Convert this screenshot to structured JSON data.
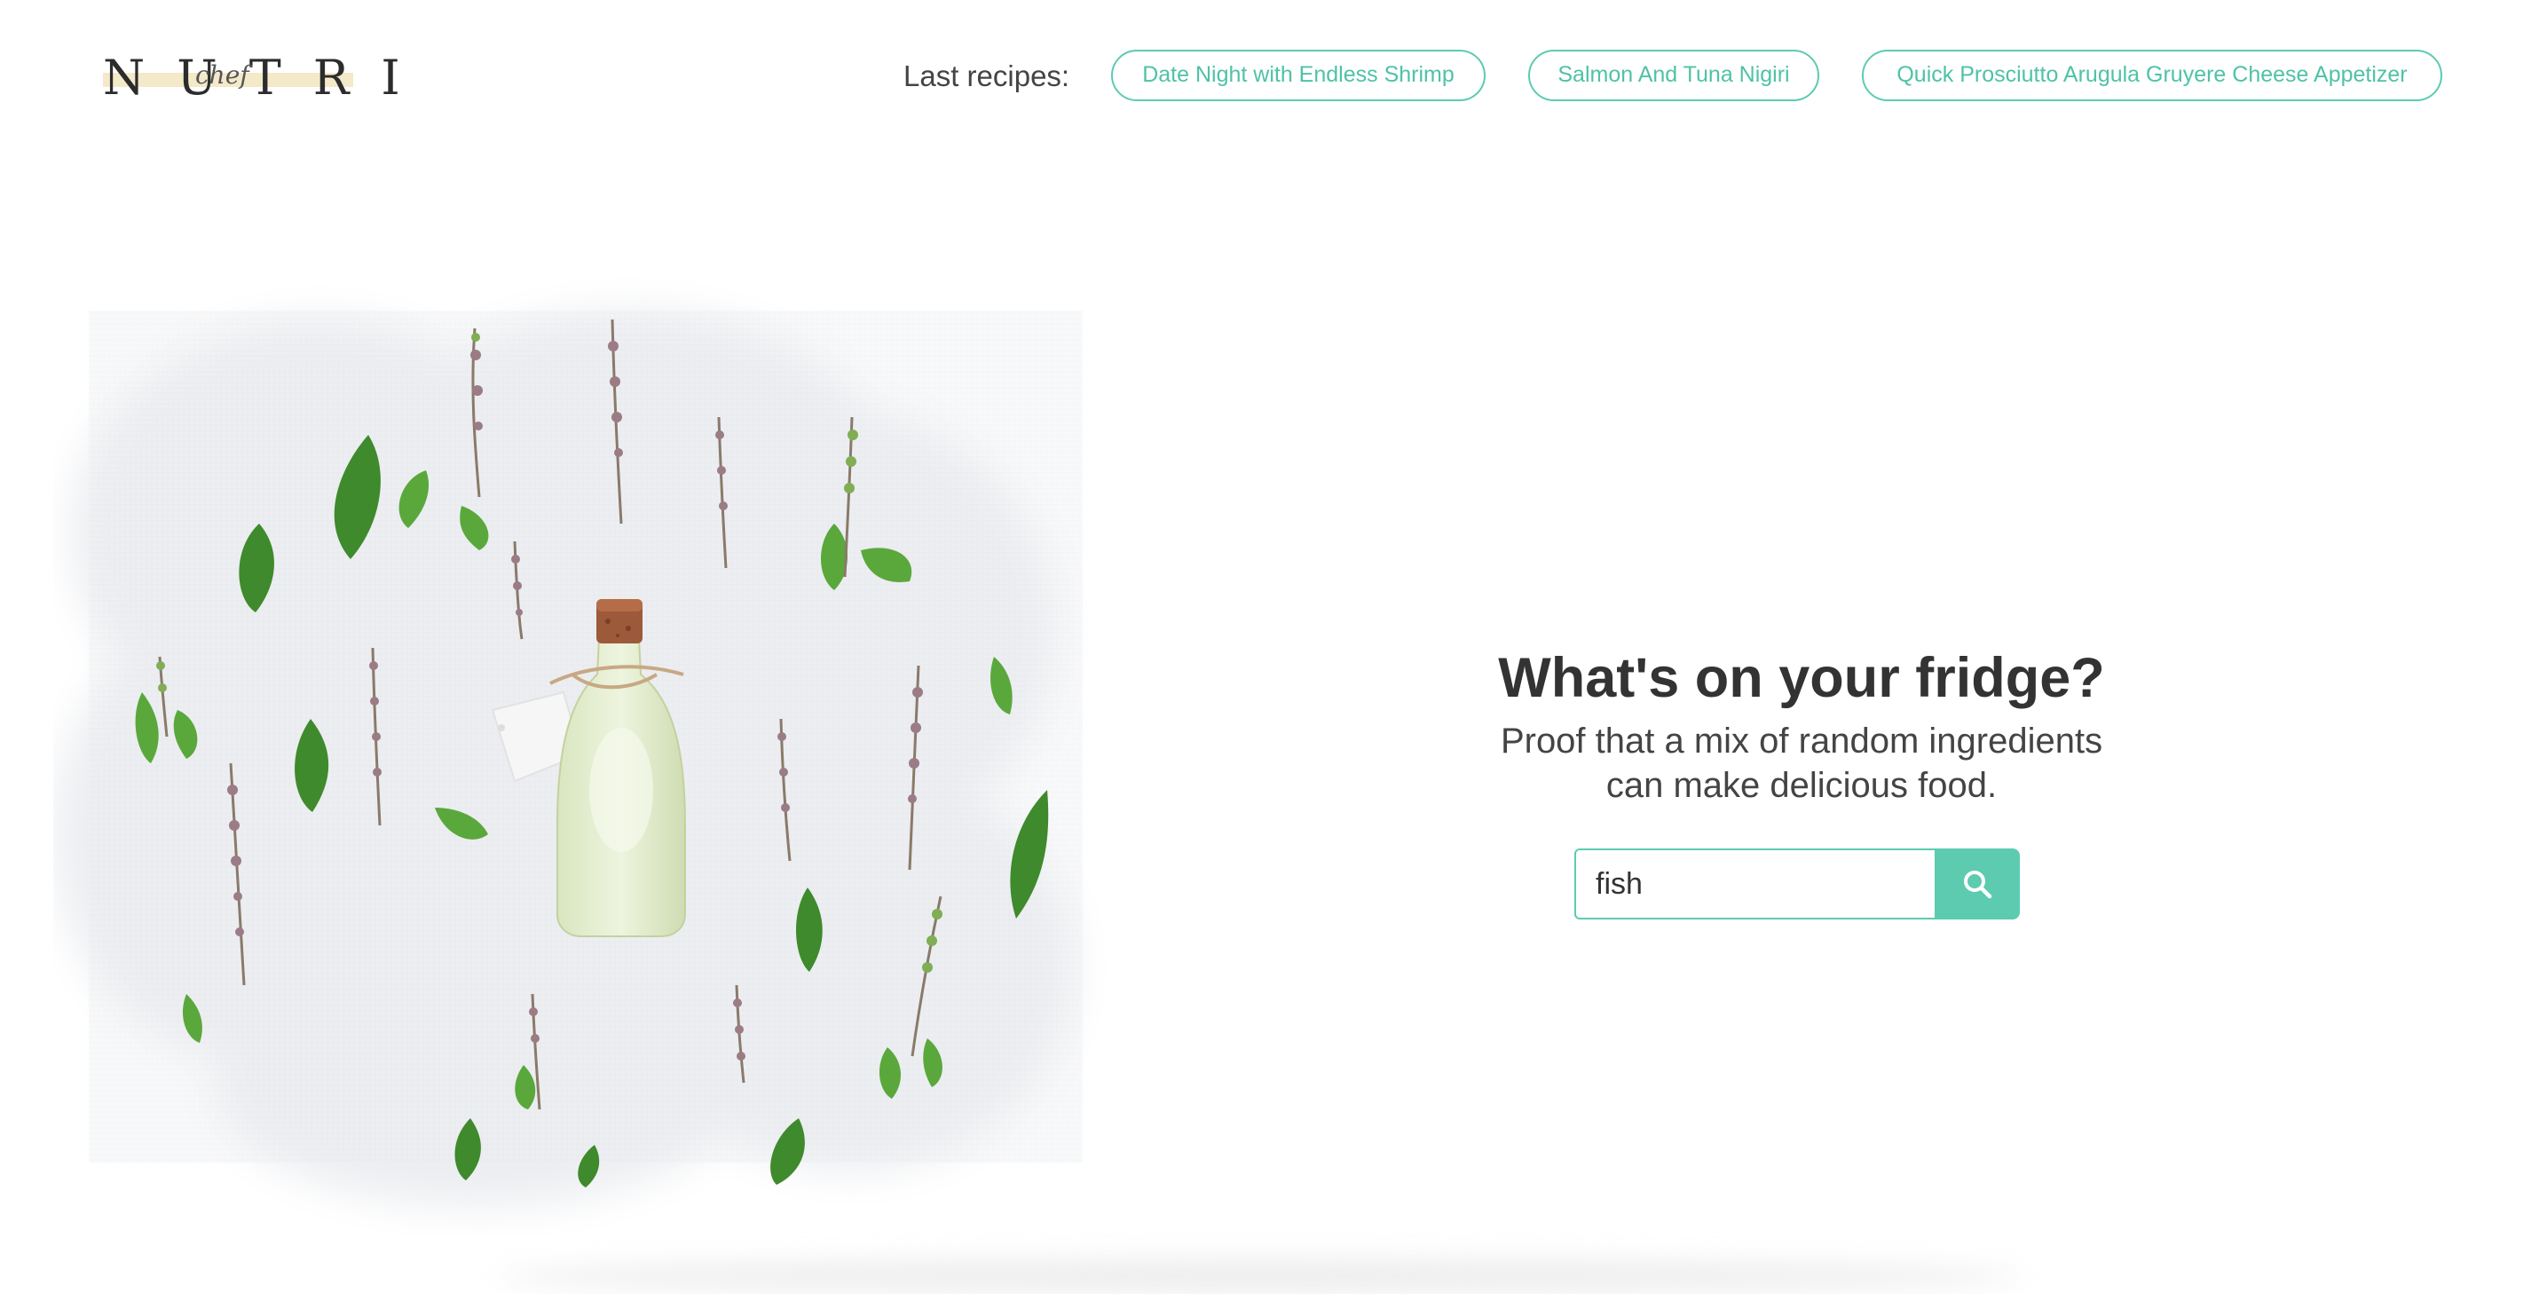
{
  "header": {
    "logo_text": "NUTRI",
    "logo_script": "chef",
    "recipes_label": "Last recipes:",
    "recipes": [
      {
        "label": "Date Night with Endless Shrimp"
      },
      {
        "label": "Salmon And Tuna Nigiri"
      },
      {
        "label": "Quick Prosciutto Arugula Gruyere Cheese Appetizer"
      }
    ]
  },
  "hero": {
    "image_icon": "herb-bottle-illustration",
    "title": "What's on your fridge?",
    "subtitle_line1": "Proof that a mix of random ingredients",
    "subtitle_line2": "can make delicious food."
  },
  "search": {
    "value": "fish",
    "button_icon": "search-icon"
  },
  "colors": {
    "accent": "#5ccbb0",
    "accent_text": "#4fc2a6",
    "logo_band": "#f4e9c8",
    "text": "#333333"
  }
}
